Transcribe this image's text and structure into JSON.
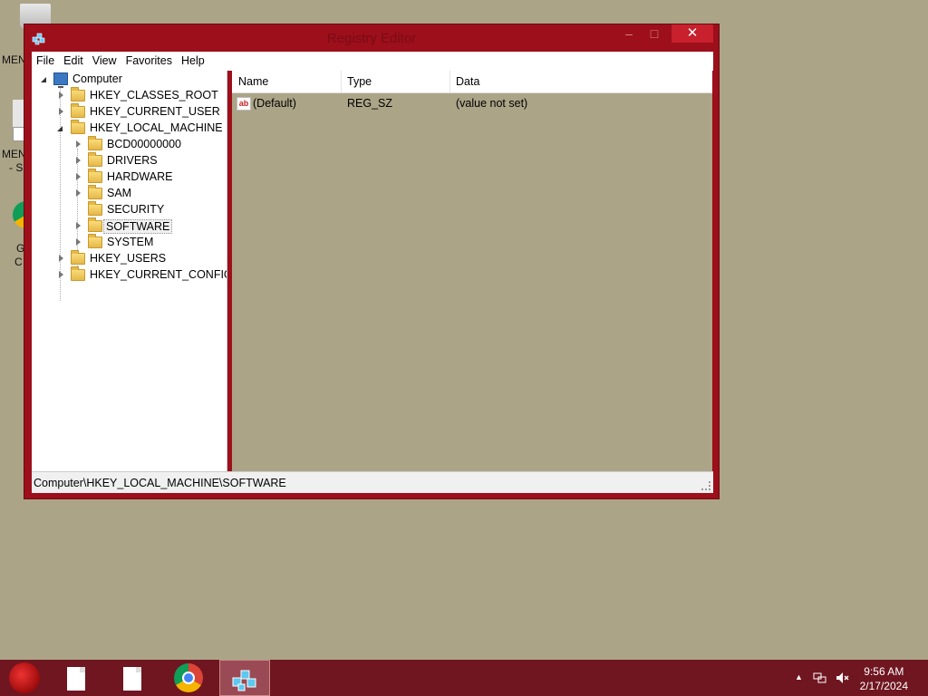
{
  "desktop": {
    "icons": [
      {
        "label": "MEN"
      },
      {
        "label": "MEN"
      },
      {
        "label": "- S"
      },
      {
        "label": "G"
      },
      {
        "label": "C"
      }
    ]
  },
  "window": {
    "title": "Registry Editor",
    "minimize_label": "–",
    "maximize_label": "□",
    "close_label": "✕"
  },
  "menu": [
    "File",
    "Edit",
    "View",
    "Favorites",
    "Help"
  ],
  "tree": {
    "root": "Computer",
    "hives": [
      "HKEY_CLASSES_ROOT",
      "HKEY_CURRENT_USER",
      "HKEY_LOCAL_MACHINE",
      "HKEY_USERS",
      "HKEY_CURRENT_CONFIG"
    ],
    "hklm_children": [
      "BCD00000000",
      "DRIVERS",
      "HARDWARE",
      "SAM",
      "SECURITY",
      "SOFTWARE",
      "SYSTEM"
    ],
    "selected": "SOFTWARE"
  },
  "list": {
    "columns": [
      "Name",
      "Type",
      "Data"
    ],
    "rows": [
      {
        "name": "(Default)",
        "type": "REG_SZ",
        "data": "(value not set)"
      }
    ]
  },
  "status": {
    "path": "Computer\\HKEY_LOCAL_MACHINE\\SOFTWARE"
  },
  "taskbar": {
    "time": "9:56 AM",
    "date": "2/17/2024"
  },
  "colors": {
    "desktop": "#aba487",
    "window_frame": "#9c0f1b",
    "taskbar": "#6f1620",
    "close_button": "#c8202c"
  }
}
